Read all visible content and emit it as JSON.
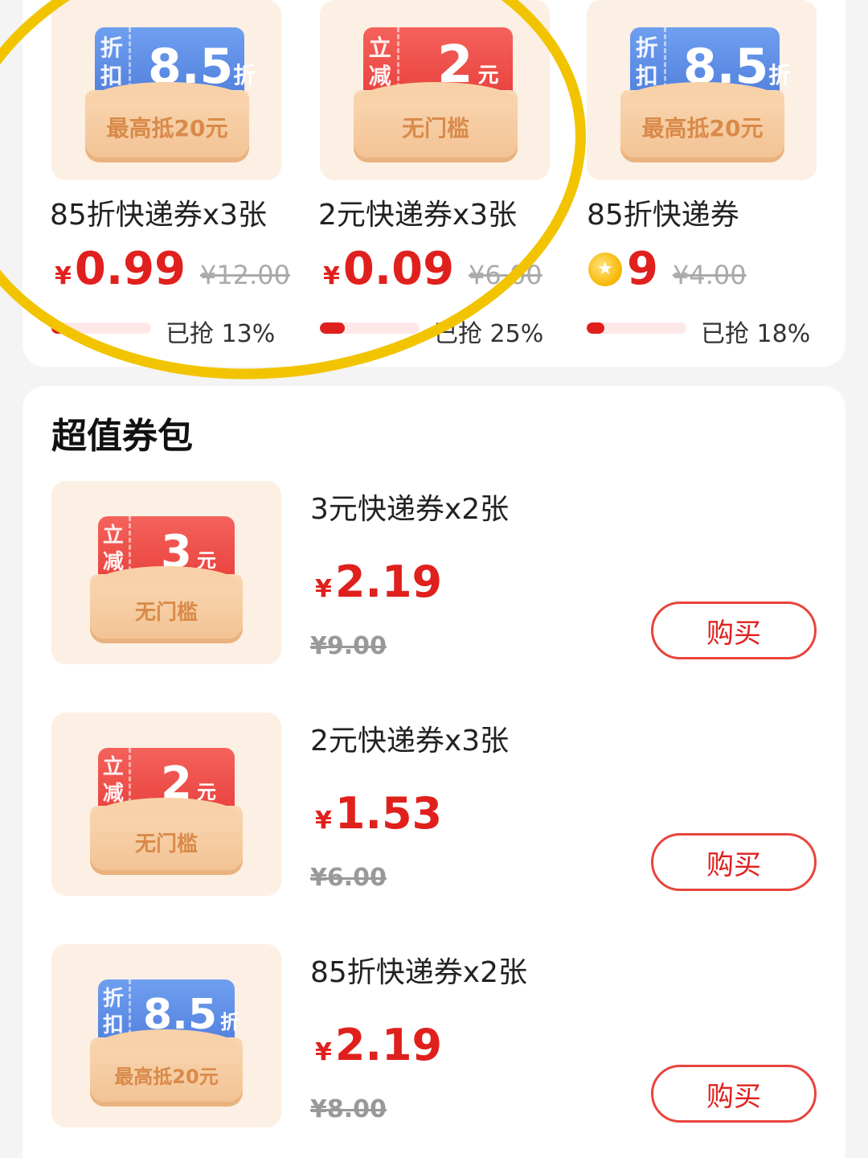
{
  "flash": {
    "items": [
      {
        "thumb": {
          "style": "blue",
          "side_top": "折",
          "side_bottom": "扣",
          "big": "8.5",
          "unit": "折",
          "envelope_text": "最高抵20元"
        },
        "name": "85折快递券x3张",
        "price_symbol": "¥",
        "price": "0.99",
        "original": "¥12.00",
        "grabbed_label": "已抢 13%",
        "grabbed_fraction": 0.13
      },
      {
        "thumb": {
          "style": "red",
          "side_top": "立",
          "side_bottom": "减",
          "big": "2",
          "unit": "元",
          "envelope_text": "无门槛"
        },
        "name": "2元快递券x3张",
        "price_symbol": "¥",
        "price": "0.09",
        "original": "¥6.00",
        "grabbed_label": "已抢 25%",
        "grabbed_fraction": 0.25
      },
      {
        "thumb": {
          "style": "blue",
          "side_top": "折",
          "side_bottom": "扣",
          "big": "8.5",
          "unit": "折",
          "envelope_text": "最高抵20元"
        },
        "name": "85折快递券",
        "price": "9",
        "price_icon": "gold-coin-icon",
        "original": "¥4.00",
        "grabbed_label": "已抢 18%",
        "grabbed_fraction": 0.18
      }
    ]
  },
  "packs": {
    "title": "超值券包",
    "items": [
      {
        "thumb": {
          "style": "red",
          "side_top": "立",
          "side_bottom": "减",
          "big": "3",
          "unit": "元",
          "envelope_text": "无门槛"
        },
        "name": "3元快递券x2张",
        "price_symbol": "¥",
        "price": "2.19",
        "original": "¥9.00",
        "button": "购买"
      },
      {
        "thumb": {
          "style": "red",
          "side_top": "立",
          "side_bottom": "减",
          "big": "2",
          "unit": "元",
          "envelope_text": "无门槛"
        },
        "name": "2元快递券x3张",
        "price_symbol": "¥",
        "price": "1.53",
        "original": "¥6.00",
        "button": "购买"
      },
      {
        "thumb": {
          "style": "blue",
          "side_top": "折",
          "side_bottom": "扣",
          "big": "8.5",
          "unit": "折",
          "envelope_text": "最高抵20元"
        },
        "name": "85折快递券x2张",
        "price_symbol": "¥",
        "price": "2.19",
        "original": "¥8.00",
        "button": "购买"
      }
    ]
  },
  "colors": {
    "accent": "#e0201d",
    "highlight": "#f2c400",
    "ticket_blue": "#4a78d8",
    "ticket_red": "#e53935"
  }
}
